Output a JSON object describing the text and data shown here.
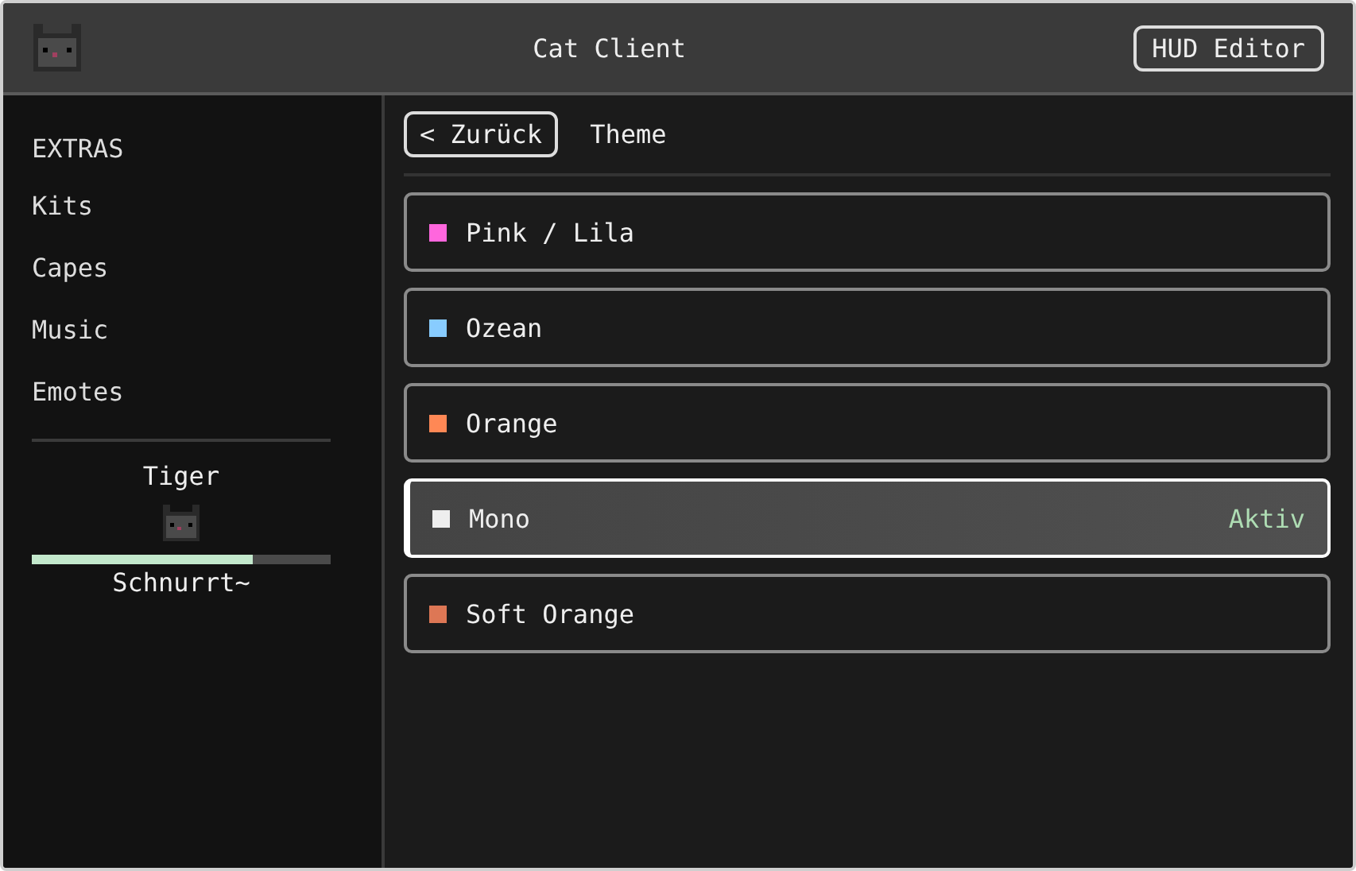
{
  "header": {
    "title": "Cat Client",
    "button": "HUD Editor"
  },
  "sidebar": {
    "section": "EXTRAS",
    "items": [
      {
        "label": "Kits"
      },
      {
        "label": "Capes"
      },
      {
        "label": "Music"
      },
      {
        "label": "Emotes"
      }
    ],
    "pet": {
      "name": "Tiger",
      "level": 0.74,
      "status": "Schnurrt~"
    }
  },
  "toolbar": {
    "back": "< Zurück",
    "title": "Theme"
  },
  "themes": [
    {
      "name": "Pink / Lila",
      "color": "#ff66dd",
      "selected": false
    },
    {
      "name": "Ozean",
      "color": "#88ccff",
      "selected": false
    },
    {
      "name": "Orange",
      "color": "#ff8855",
      "selected": false
    },
    {
      "name": "Mono",
      "color": "#eeeeee",
      "selected": true,
      "badge": "Aktiv"
    },
    {
      "name": "Soft Orange",
      "color": "#dd7755",
      "selected": false
    }
  ]
}
